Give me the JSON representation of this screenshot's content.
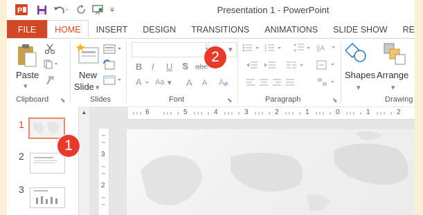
{
  "title_bar": {
    "title": "Presentation 1 - PowerPoint",
    "icons": [
      "powerpoint-logo",
      "save-icon",
      "undo-icon",
      "redo-icon",
      "present-icon",
      "customize-qat-icon"
    ]
  },
  "tabs": [
    "FILE",
    "HOME",
    "INSERT",
    "DESIGN",
    "TRANSITIONS",
    "ANIMATIONS",
    "SLIDE SHOW",
    "RE"
  ],
  "active_tab": "HOME",
  "ribbon": {
    "clipboard": {
      "label": "Clipboard",
      "paste": "Paste"
    },
    "slides": {
      "label": "Slides",
      "new_slide_line1": "New",
      "new_slide_line2": "Slide"
    },
    "font": {
      "label": "Font",
      "bold": "B",
      "italic": "I",
      "underline": "U",
      "shadow": "S",
      "strike": "abc",
      "case": "Aa",
      "grow": "A",
      "shrink": "A"
    },
    "paragraph": {
      "label": "Paragraph"
    },
    "drawing": {
      "label": "Drawing",
      "shapes": "Shapes",
      "arrange": "Arrange"
    }
  },
  "badges": {
    "one": "1",
    "two": "2"
  },
  "slides": [
    {
      "number": "1",
      "selected": true
    },
    {
      "number": "2",
      "selected": false
    },
    {
      "number": "3",
      "selected": false
    }
  ],
  "ruler": {
    "horizontal": [
      "6",
      "5",
      "4",
      "3",
      "2",
      "1",
      "0",
      "1",
      "2"
    ],
    "vertical": [
      "3",
      "2"
    ]
  },
  "colors": {
    "accent": "#d24726",
    "badge": "#e53b2c",
    "page_bg": "#fbf0d6"
  }
}
